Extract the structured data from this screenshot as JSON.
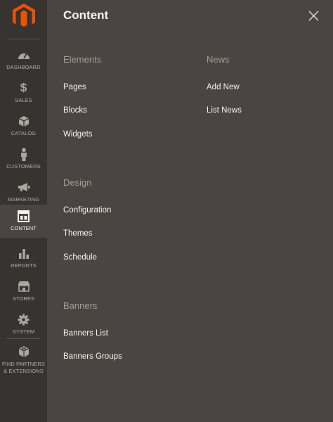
{
  "sidebar": {
    "items": [
      {
        "label": "DASHBOARD",
        "icon": "dashboard-icon"
      },
      {
        "label": "SALES",
        "icon": "dollar-icon"
      },
      {
        "label": "CATALOG",
        "icon": "box-icon"
      },
      {
        "label": "CUSTOMERS",
        "icon": "person-icon"
      },
      {
        "label": "MARKETING",
        "icon": "megaphone-icon"
      },
      {
        "label": "CONTENT",
        "icon": "layout-icon",
        "active": true
      },
      {
        "label": "REPORTS",
        "icon": "bar-chart-icon"
      },
      {
        "label": "STORES",
        "icon": "storefront-icon"
      },
      {
        "label": "SYSTEM",
        "icon": "gear-icon"
      },
      {
        "label_line1": "FIND PARTNERS",
        "label_line2": "& EXTENSIONS",
        "icon": "cubes-icon"
      }
    ]
  },
  "panel": {
    "title": "Content",
    "sections": {
      "elements": {
        "title": "Elements",
        "links": [
          "Pages",
          "Blocks",
          "Widgets"
        ]
      },
      "news": {
        "title": "News",
        "links": [
          "Add New",
          "List News"
        ]
      },
      "design": {
        "title": "Design",
        "links": [
          "Configuration",
          "Themes",
          "Schedule"
        ]
      },
      "banners": {
        "title": "Banners",
        "links": [
          "Banners List",
          "Banners Groups"
        ]
      }
    }
  },
  "colors": {
    "sidebar_bg": "#373330",
    "panel_bg": "#4a4542",
    "logo_orange": "#eb5202",
    "section_title": "#a79d95",
    "link_text": "#f7f3eb"
  }
}
